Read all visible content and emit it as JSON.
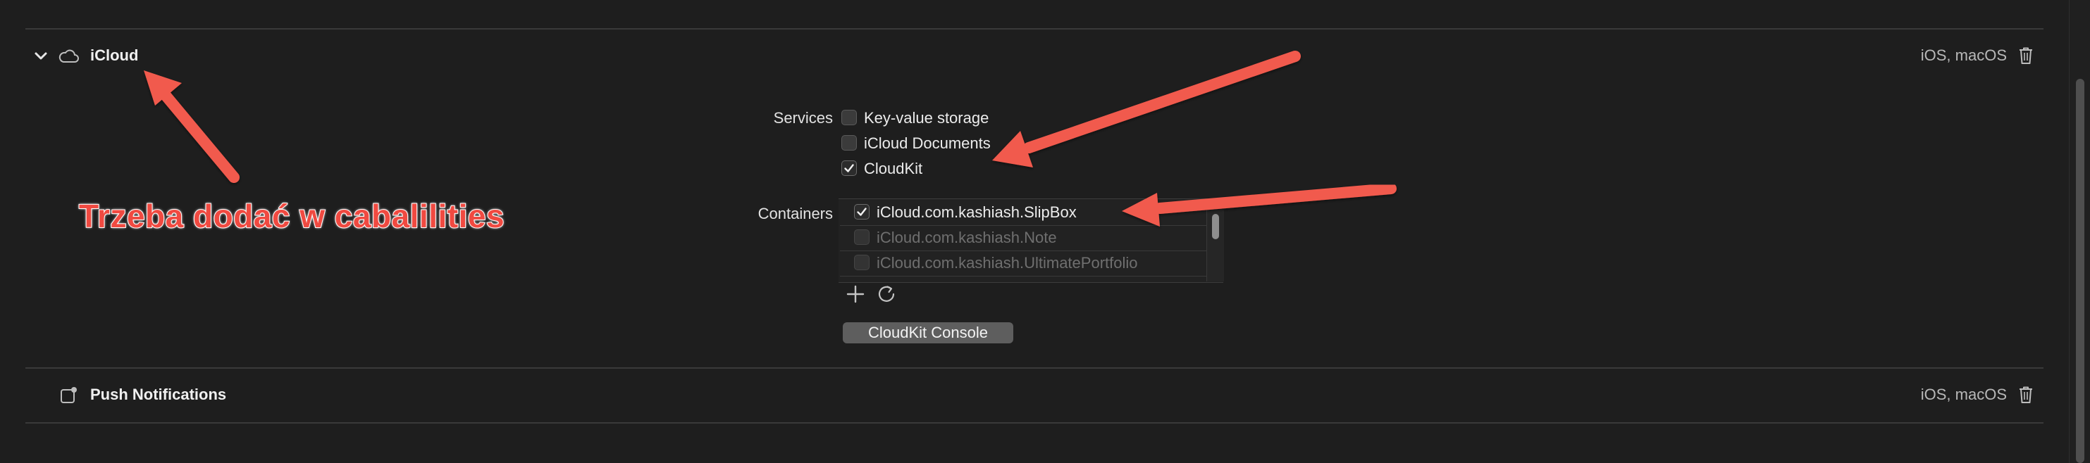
{
  "icloud_section": {
    "title": "iCloud",
    "platforms": "iOS, macOS",
    "services_label": "Services",
    "services": [
      {
        "label": "Key-value storage",
        "checked": false
      },
      {
        "label": "iCloud Documents",
        "checked": false
      },
      {
        "label": "CloudKit",
        "checked": true
      }
    ],
    "containers_label": "Containers",
    "containers": [
      {
        "label": "iCloud.com.kashiash.SlipBox",
        "checked": true,
        "enabled": true
      },
      {
        "label": "iCloud.com.kashiash.Note",
        "checked": false,
        "enabled": false
      },
      {
        "label": "iCloud.com.kashiash.UltimatePortfolio",
        "checked": false,
        "enabled": false
      }
    ],
    "console_button": "CloudKit Console"
  },
  "push_section": {
    "title": "Push Notifications",
    "platforms": "iOS, macOS"
  },
  "annotation": {
    "text": "Trzeba dodać w cabalilities",
    "color": "#f04a41"
  },
  "icons": {
    "chevron": "chevron-down-icon",
    "cloud": "cloud-icon",
    "trash": "trash-icon",
    "add": "plus-icon",
    "refresh": "refresh-icon",
    "push": "push-notification-icon"
  }
}
